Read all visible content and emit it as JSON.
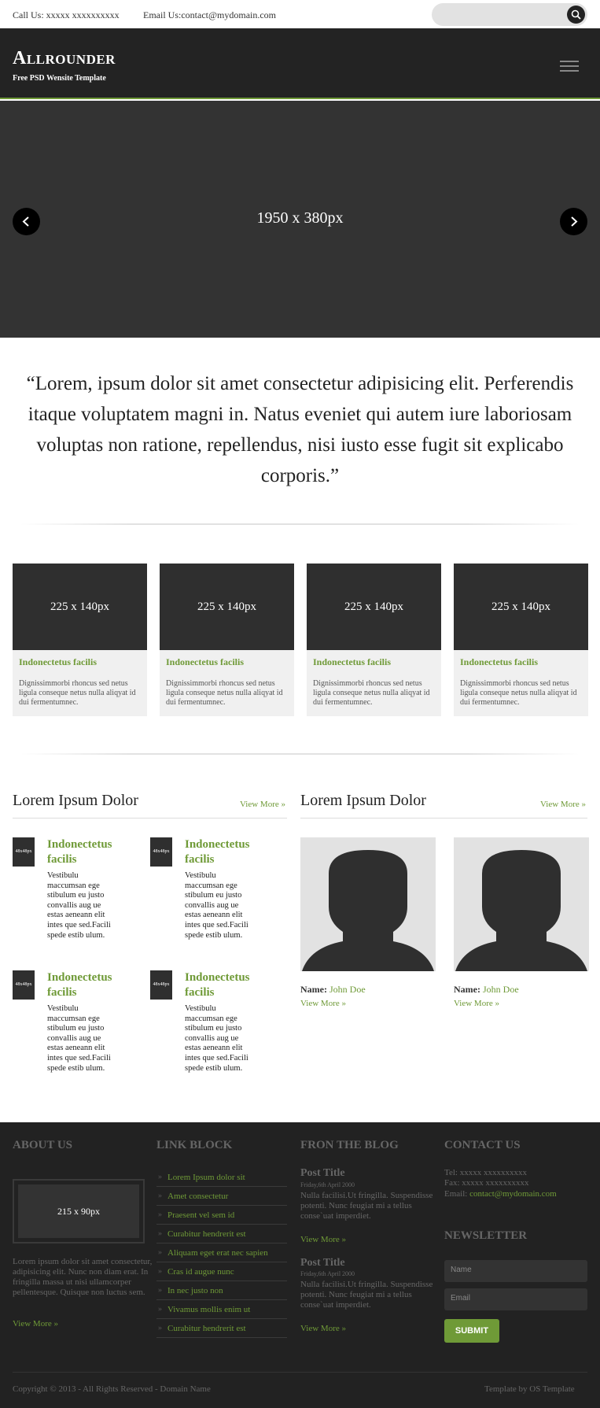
{
  "topbar": {
    "call": "Call Us: xxxxx xxxxxxxxxx",
    "email": "Email Us:contact@mydomain.com"
  },
  "header": {
    "logo": "Allrounder",
    "tagline": "Free PSD Wensite Template"
  },
  "slider": {
    "label": "1950 x 380px"
  },
  "quote": "“Lorem, ipsum dolor sit amet consectetur adipisicing elit. Perferendis itaque voluptatem magni in. Natus eveniet qui autem iure laboriosam voluptas non ratione, repellendus, nisi iusto esse fugit sit explicabo corporis.”",
  "features": [
    {
      "img": "225 x 140px",
      "title": "Indonectetus facilis",
      "text": "Dignissimmorbi rhoncus sed netus ligula conseque netus nulla aliqyat id dui fermentumnec."
    },
    {
      "img": "225 x 140px",
      "title": "Indonectetus facilis",
      "text": "Dignissimmorbi rhoncus sed netus ligula conseque netus nulla aliqyat id dui fermentumnec."
    },
    {
      "img": "225 x 140px",
      "title": "Indonectetus facilis",
      "text": "Dignissimmorbi rhoncus sed netus ligula conseque netus nulla aliqyat id dui fermentumnec."
    },
    {
      "img": "225 x 140px",
      "title": "Indonectetus facilis",
      "text": "Dignissimmorbi rhoncus sed netus ligula conseque netus nulla aliqyat id dui fermentumnec."
    }
  ],
  "posts_section": {
    "title": "Lorem Ipsum Dolor",
    "view_more": "View More »",
    "posts": [
      {
        "thumb": "48x48px",
        "title": "Indonectetus facilis",
        "text": "Vestibulu maccumsan ege stibulum eu justo convallis aug ue estas aeneann elit intes que sed.Facili spede estib ulum."
      },
      {
        "thumb": "48x48px",
        "title": "Indonectetus facilis",
        "text": "Vestibulu maccumsan ege stibulum eu justo convallis aug ue estas aeneann elit intes que sed.Facili spede estib ulum."
      },
      {
        "thumb": "48x48px",
        "title": "Indonectetus facilis",
        "text": "Vestibulu maccumsan ege stibulum eu justo convallis aug ue estas aeneann elit intes que sed.Facili spede estib ulum."
      },
      {
        "thumb": "48x48px",
        "title": "Indonectetus facilis",
        "text": "Vestibulu maccumsan ege stibulum eu justo convallis aug ue estas aeneann elit intes que sed.Facili spede estib ulum."
      }
    ]
  },
  "team_section": {
    "title": "Lorem Ipsum Dolor",
    "view_more": "View More »",
    "members": [
      {
        "name_label": "Name:",
        "name": "John Doe",
        "view_more": "View More »"
      },
      {
        "name_label": "Name:",
        "name": "John Doe",
        "view_more": "View More »"
      }
    ]
  },
  "footer": {
    "about": {
      "heading": "ABOUT US",
      "img": "215 x 90px",
      "text": "Lorem ipsum dolor sit amet consectetur, adipisicing elit. Nunc non diam erat. In fringilla massa ut nisi ullamcorper pellentesque. Quisque non luctus sem.",
      "view_more": "View More »"
    },
    "links": {
      "heading": "LINK BLOCK",
      "items": [
        "Lorem Ipsum dolor sit",
        "Amet consectetur",
        "Praesent vel sem id",
        "Curabitur hendrerit est",
        "Aliquam eget erat nec sapien",
        "Cras id augue nunc",
        "In nec justo non",
        "Vivamus mollis enim ut",
        "Curabitur hendrerit est"
      ]
    },
    "blog": {
      "heading": "FRON THE BLOG",
      "posts": [
        {
          "title": "Post Title",
          "date": "Friday,6th April 2000",
          "text": "Nulla facilisi.Ut fringilla. Suspendisse potenti. Nunc feugiat mi a tellus conse`uat imperdiet.",
          "view_more": "View More »"
        },
        {
          "title": "Post Title",
          "date": "Friday,6th April 2000",
          "text": "Nulla facilisi.Ut fringilla. Suspendisse potenti. Nunc feugiat mi a tellus conse`uat imperdiet.",
          "view_more": "View More »"
        }
      ]
    },
    "contact": {
      "heading": "CONTACT US",
      "tel": "Tel: xxxxx xxxxxxxxxx",
      "fax": "Fax: xxxxx xxxxxxxxxx",
      "email_label": "Email:",
      "email": "contact@mydomain.com"
    },
    "newsletter": {
      "heading": "NEWSLETTER",
      "name_placeholder": "Name",
      "email_placeholder": "Email",
      "submit": "SUBMIT"
    },
    "copyright": "Copyright © 2013 - All Rights Reserved - Domain Name",
    "credit": "Template by OS Template"
  },
  "colors": {
    "accent": "#6f9a37",
    "header_bg": "#232323",
    "footer_bg": "#222222"
  }
}
